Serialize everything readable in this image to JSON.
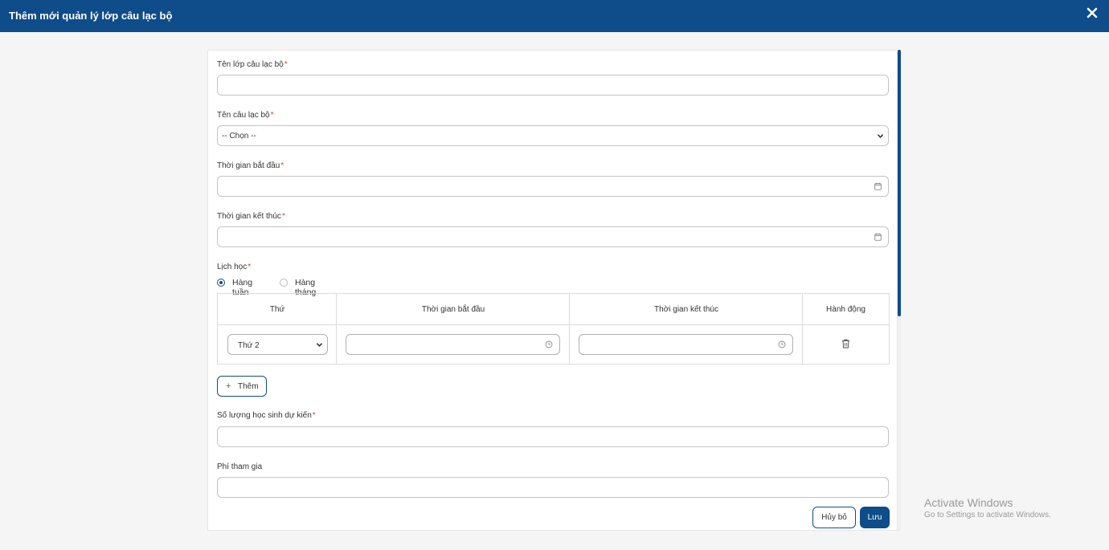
{
  "header": {
    "title": "Thêm mới quản lý lớp câu lạc bộ",
    "close_icon": "close-icon"
  },
  "form": {
    "class_name": {
      "label": "Tên lớp câu lạc bộ",
      "required": "*",
      "value": ""
    },
    "club_name": {
      "label": "Tên câu lạc bộ",
      "required": "*",
      "selected": "-- Chọn --"
    },
    "start_time": {
      "label": "Thời gian bắt đầu",
      "required": "*",
      "value": ""
    },
    "end_time": {
      "label": "Thời gian kết thúc",
      "required": "*",
      "value": ""
    },
    "schedule": {
      "label": "Lịch học",
      "required": "*",
      "options": [
        {
          "label": "Hàng tuần",
          "checked": true
        },
        {
          "label": "Hàng tháng",
          "checked": false
        }
      ],
      "columns": [
        "Thứ",
        "Thời gian bắt đầu",
        "Thời gian kết thúc",
        "Hành động"
      ],
      "rows": [
        {
          "day": "Thứ 2",
          "start": "",
          "end": ""
        }
      ],
      "add_label": "Thêm"
    },
    "student_count": {
      "label": "Số lượng học sinh dự kiến",
      "required": "*",
      "value": ""
    },
    "fee": {
      "label": "Phí tham gia",
      "value": ""
    }
  },
  "actions": {
    "cancel_label": "Hủy bỏ",
    "save_label": "Lưu"
  },
  "watermark": {
    "line1": "Activate Windows",
    "line2": "Go to Settings to activate Windows."
  },
  "colors": {
    "primary": "#0f4c8a",
    "required": "#e53935"
  }
}
